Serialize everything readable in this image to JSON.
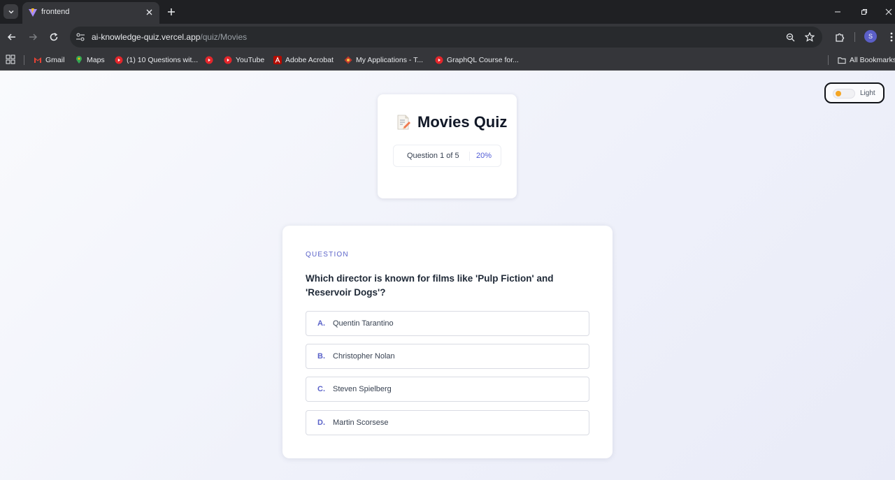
{
  "browser": {
    "tab_title": "frontend",
    "url_host": "ai-knowledge-quiz.vercel.app",
    "url_path": "/quiz/Movies",
    "profile_initial": "S"
  },
  "bookmarks": [
    {
      "label": "Gmail",
      "icon": "gmail-icon"
    },
    {
      "label": "Maps",
      "icon": "maps-icon"
    },
    {
      "label": "(1) 10 Questions wit...",
      "icon": "youtube-icon"
    },
    {
      "label": "",
      "icon": "youtube-icon"
    },
    {
      "label": "YouTube",
      "icon": "youtube-icon"
    },
    {
      "label": "Adobe Acrobat",
      "icon": "acrobat-icon"
    },
    {
      "label": "My Applications - T...",
      "icon": "app-icon"
    },
    {
      "label": "GraphQL Course for...",
      "icon": "youtube-icon"
    }
  ],
  "all_bookmarks_label": "All Bookmarks",
  "theme": {
    "label": "Light"
  },
  "quiz": {
    "title": "Movies Quiz",
    "progress_text": "Question 1 of 5",
    "progress_percent": "20%"
  },
  "question": {
    "label": "QUESTION",
    "text": "Which director is known for films like 'Pulp Fiction' and 'Reservoir Dogs'?",
    "options": [
      {
        "letter": "A.",
        "text": "Quentin Tarantino"
      },
      {
        "letter": "B.",
        "text": "Christopher Nolan"
      },
      {
        "letter": "C.",
        "text": "Steven Spielberg"
      },
      {
        "letter": "D.",
        "text": "Martin Scorsese"
      }
    ]
  },
  "colors": {
    "accent": "#5b63c9",
    "toggle_knob": "#f5a623",
    "chrome_dark": "#35363a"
  }
}
